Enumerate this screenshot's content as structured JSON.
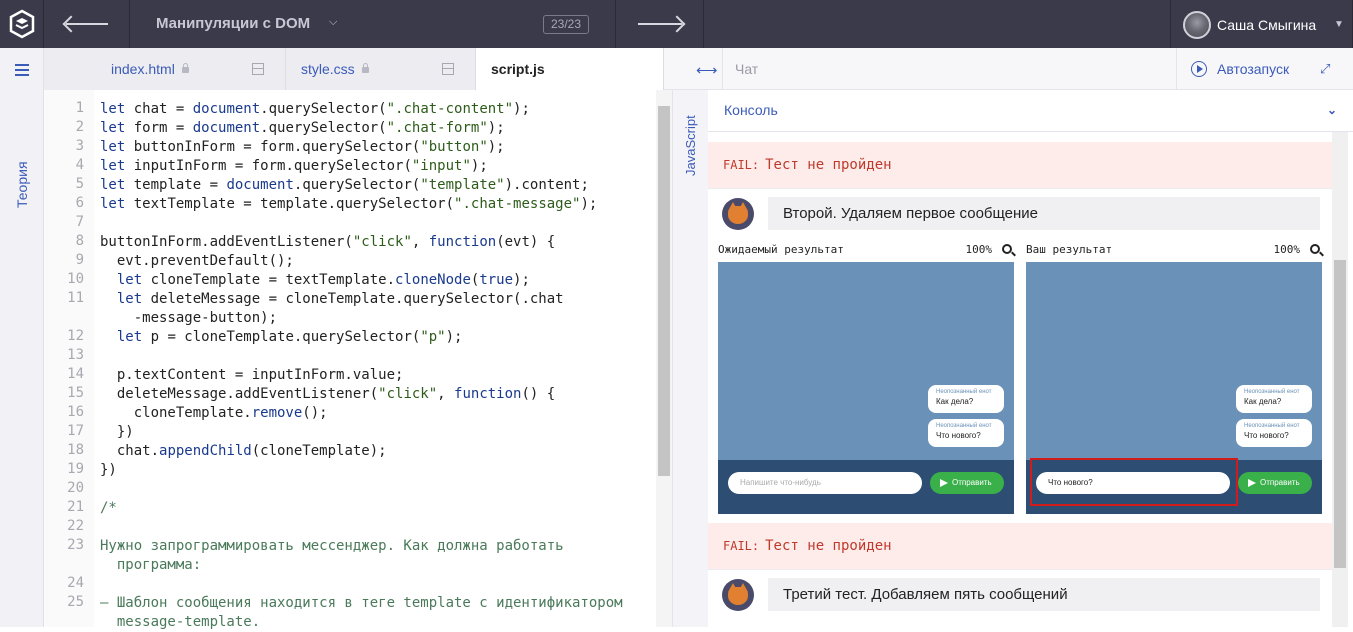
{
  "topbar": {
    "title": "Манипуляции с DOM",
    "counter": "23/23",
    "username": "Саша Смыгина"
  },
  "sidebar": {
    "theory_label": "Теория"
  },
  "tabs": [
    {
      "label": "index.html"
    },
    {
      "label": "style.css"
    },
    {
      "label": "script.js"
    }
  ],
  "editor": {
    "language": "JavaScript"
  },
  "right": {
    "chat_label": "Чат",
    "autorun_label": "Автозапуск",
    "console_label": "Консоль"
  },
  "tests": [
    {
      "fail_label": "FAIL:",
      "fail_text": "Тест не пройден",
      "name": "Второй. Удаляем первое сообщение",
      "expected_label": "Ожидаемый результат",
      "actual_label": "Ваш результат",
      "zoom": "100%",
      "messages": [
        {
          "author": "Неопознанный енот",
          "text": "Как дела?"
        },
        {
          "author": "Неопознанный енот",
          "text": "Что нового?"
        }
      ],
      "expected_input_placeholder": "Напишите что-нибудь",
      "actual_input_value": "Что нового?",
      "send_label": "Отправить"
    },
    {
      "fail_label": "FAIL:",
      "fail_text": "Тест не пройден",
      "name": "Третий тест. Добавляем пять сообщений"
    }
  ],
  "code_lines": [
    {
      "n": "1",
      "t": "let chat = document.querySelector(\".chat-content\");"
    },
    {
      "n": "2",
      "t": "let form = document.querySelector(\".chat-form\");"
    },
    {
      "n": "3",
      "t": "let buttonInForm = form.querySelector(\"button\");"
    },
    {
      "n": "4",
      "t": "let inputInForm = form.querySelector(\"input\");"
    },
    {
      "n": "5",
      "t": "let template = document.querySelector(\"template\").content;"
    },
    {
      "n": "6",
      "t": "let textTemplate = template.querySelector(\".chat-message\");"
    },
    {
      "n": "7",
      "t": ""
    },
    {
      "n": "8",
      "t": "buttonInForm.addEventListener(\"click\", function(evt) {"
    },
    {
      "n": "9",
      "t": "  evt.preventDefault();"
    },
    {
      "n": "10",
      "t": "  let cloneTemplate = textTemplate.cloneNode(true);"
    },
    {
      "n": "11",
      "t": "  let deleteMessage = cloneTemplate.querySelector(\".chat"
    },
    {
      "n": "",
      "t": "    -message-button\");"
    },
    {
      "n": "12",
      "t": "  let p = cloneTemplate.querySelector(\"p\");"
    },
    {
      "n": "13",
      "t": ""
    },
    {
      "n": "14",
      "t": "  p.textContent = inputInForm.value;"
    },
    {
      "n": "15",
      "t": "  deleteMessage.addEventListener(\"click\", function() {"
    },
    {
      "n": "16",
      "t": "    cloneTemplate.remove();"
    },
    {
      "n": "17",
      "t": "  })"
    },
    {
      "n": "18",
      "t": "  chat.appendChild(cloneTemplate);"
    },
    {
      "n": "19",
      "t": "})"
    },
    {
      "n": "20",
      "t": ""
    },
    {
      "n": "21",
      "t": "/*"
    },
    {
      "n": "22",
      "t": ""
    },
    {
      "n": "23",
      "t": "Нужно запрограммировать мессенджер. Как должна работать"
    },
    {
      "n": "",
      "t": "  программа:"
    },
    {
      "n": "24",
      "t": ""
    },
    {
      "n": "25",
      "t": "— Шаблон сообщения находится в теге template с идентификатором"
    },
    {
      "n": "",
      "t": "  message-template."
    }
  ]
}
